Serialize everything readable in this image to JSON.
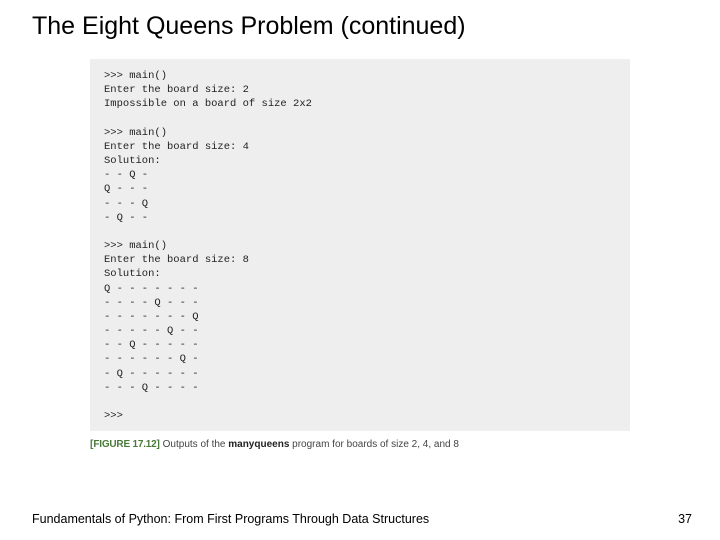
{
  "title": "The Eight Queens Problem (continued)",
  "code": ">>> main()\nEnter the board size: 2\nImpossible on a board of size 2x2\n\n>>> main()\nEnter the board size: 4\nSolution:\n- - Q -\nQ - - -\n- - - Q\n- Q - -\n\n>>> main()\nEnter the board size: 8\nSolution:\nQ - - - - - - -\n- - - - Q - - -\n- - - - - - - Q\n- - - - - Q - -\n- - Q - - - - -\n- - - - - - Q -\n- Q - - - - - -\n- - - Q - - - -\n\n>>>",
  "caption": {
    "figure_label_open": "[",
    "figure_label": "FIGURE 17.12",
    "figure_label_close": "]",
    "text_before": " Outputs of the ",
    "program": "manyqueens",
    "text_after": " program for boards of size 2, 4, and 8"
  },
  "footer": {
    "left": "Fundamentals of Python: From First Programs Through Data Structures",
    "right": "37"
  }
}
